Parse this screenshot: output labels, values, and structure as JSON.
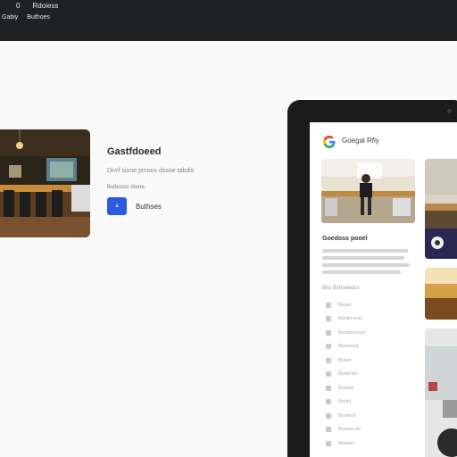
{
  "topbar": {
    "icon_label": "0",
    "nav_label": "Rdoiess",
    "sub_left": "Gabiy",
    "sub_right": "Buthoes"
  },
  "left_panel": {
    "title": "Gastfdoeed",
    "subtitle": "Divrḟ sione pmoos dssoe tabdis.",
    "meta": "Buibcoos rbone.",
    "action_icon": "a",
    "action_label": "Buthses"
  },
  "tablet": {
    "header_title": "Goegal Rfiy",
    "section_title": "Goedoss pooel",
    "subhead": "Bris Bsbseedss",
    "list_items": [
      "Bsoud",
      "Bsosbcvese",
      "Bsosbeceosd",
      "Bsoseood",
      "Bssod",
      "Bsosd bd",
      "Bsoebd",
      "Bsebd",
      "Bsoseod",
      "Bsoooe sld",
      "Bsoeod"
    ]
  },
  "colors": {
    "topbar_bg": "#1f2123",
    "accent_blue": "#2a5adf",
    "tablet_frame": "#1b1b1b"
  }
}
